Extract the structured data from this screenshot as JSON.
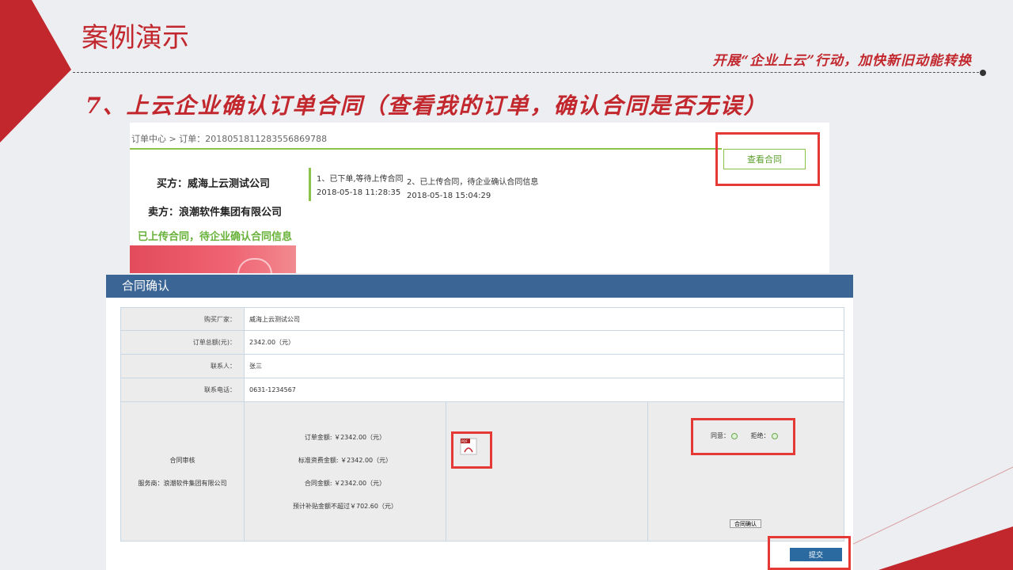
{
  "slide": {
    "title": "案例演示",
    "slogan": "开展“企业上云”行动，加快新旧动能转换",
    "step": "7、上云企业确认订单合同（查看我的订单，确认合同是否无误）"
  },
  "order": {
    "breadcrumb": "订单中心 > 订单：2018051811283556869788",
    "view_contract_label": "查看合同",
    "buyer": "买方：威海上云测试公司",
    "seller": "卖方：浪潮软件集团有限公司",
    "status": "已上传合同，待企业确认合同信息",
    "timeline": [
      {
        "text": "1、已下单,等待上传合同",
        "time": "2018-05-18 11:28:35"
      },
      {
        "text": "2、已上传合同，待企业确认合同信息",
        "time": "2018-05-18 15:04:29"
      }
    ]
  },
  "contract": {
    "header": "合同确认",
    "rows": [
      {
        "label": "购买厂家：",
        "value": "威海上云测试公司"
      },
      {
        "label": "订单总额(元)：",
        "value": "2342.00（元）"
      },
      {
        "label": "联系人：",
        "value": "张三"
      },
      {
        "label": "联系电话：",
        "value": "0631-1234567"
      }
    ],
    "review_label": "合同审核",
    "provider": "服务商：浪潮软件集团有限公司",
    "amounts": [
      "订单金额: ￥2342.00（元）",
      "标准资费金额: ￥2342.00（元）",
      "合同金额: ￥2342.00（元）",
      "预计补贴金额不超过￥702.60（元）"
    ],
    "pdf_icon": "pdf-file-icon",
    "pdf_badge": "PDF",
    "agree_label": "同意：",
    "reject_label": "拒绝：",
    "confirm_button": "合同确认",
    "submit_button": "提交"
  },
  "colors": {
    "accent_red": "#c1272d",
    "green": "#8bc34a",
    "header_blue": "#3b6594",
    "highlight_red": "#e53935"
  }
}
